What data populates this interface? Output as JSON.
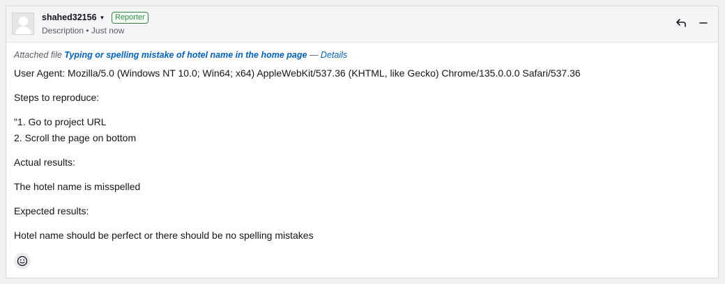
{
  "header": {
    "author": "shahed32156",
    "badge": "Reporter",
    "subtitle": "Description • Just now",
    "actions": [
      "reply-icon",
      "collapse-icon"
    ]
  },
  "attachment": {
    "prefix": "Attached file ",
    "link": "Typing or spelling mistake of hotel name in the home page",
    "separator": " — ",
    "details": "Details"
  },
  "body": {
    "user_agent": "User Agent: Mozilla/5.0 (Windows NT 10.0; Win64; x64) AppleWebKit/537.36 (KHTML, like Gecko) Chrome/135.0.0.0 Safari/537.36",
    "steps_heading": "Steps to reproduce:",
    "step1": "\"1. Go to project URL",
    "step2": "2. Scroll the page on bottom",
    "actual_heading": "Actual results:",
    "actual": "The hotel name is misspelled",
    "expected_heading": "Expected results:",
    "expected": "Hotel name should be perfect or there should be no spelling mistakes"
  },
  "reaction": {
    "icon": "smiley-icon"
  },
  "colors": {
    "link": "#0061c3",
    "badge": "#2b8a3e",
    "muted": "#5b5b66"
  }
}
